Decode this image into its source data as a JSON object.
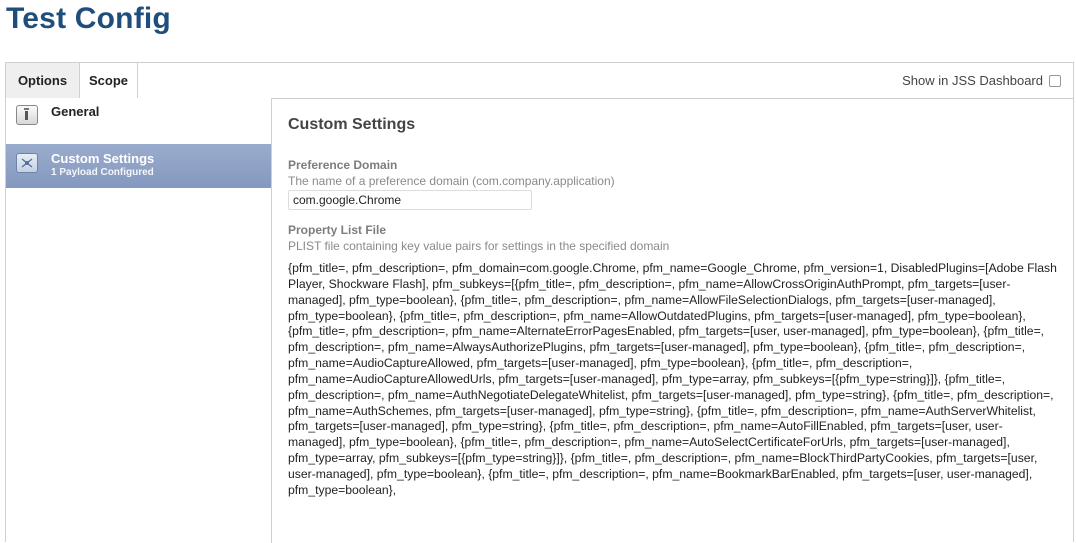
{
  "page": {
    "title": "Test Config"
  },
  "tabs": [
    {
      "label": "Options",
      "active": true
    },
    {
      "label": "Scope",
      "active": false
    }
  ],
  "dashboard": {
    "label": "Show in JSS Dashboard",
    "checked": false
  },
  "sidebar": {
    "items": [
      {
        "label": "General",
        "icon": "general-payload-icon"
      },
      {
        "label": "Custom Settings",
        "subtitle": "1 Payload Configured",
        "icon": "custom-settings-icon",
        "selected": true
      }
    ]
  },
  "main": {
    "section_title": "Custom Settings",
    "preference_domain": {
      "label": "Preference Domain",
      "description": "The name of a preference domain (com.company.application)",
      "value": "com.google.Chrome"
    },
    "plist": {
      "label": "Property List File",
      "description": "PLIST file containing key value pairs for settings in the specified domain",
      "content": "{pfm_title=, pfm_description=, pfm_domain=com.google.Chrome, pfm_name=Google_Chrome, pfm_version=1, DisabledPlugins=[Adobe Flash Player, Shockware Flash], pfm_subkeys=[{pfm_title=, pfm_description=, pfm_name=AllowCrossOriginAuthPrompt, pfm_targets=[user-managed], pfm_type=boolean}, {pfm_title=, pfm_description=, pfm_name=AllowFileSelectionDialogs, pfm_targets=[user-managed], pfm_type=boolean}, {pfm_title=, pfm_description=, pfm_name=AllowOutdatedPlugins, pfm_targets=[user-managed], pfm_type=boolean}, {pfm_title=, pfm_description=, pfm_name=AlternateErrorPagesEnabled, pfm_targets=[user, user-managed], pfm_type=boolean}, {pfm_title=, pfm_description=, pfm_name=AlwaysAuthorizePlugins, pfm_targets=[user-managed], pfm_type=boolean}, {pfm_title=, pfm_description=, pfm_name=AudioCaptureAllowed, pfm_targets=[user-managed], pfm_type=boolean}, {pfm_title=, pfm_description=, pfm_name=AudioCaptureAllowedUrls, pfm_targets=[user-managed], pfm_type=array, pfm_subkeys=[{pfm_type=string}]}, {pfm_title=, pfm_description=, pfm_name=AuthNegotiateDelegateWhitelist, pfm_targets=[user-managed], pfm_type=string}, {pfm_title=, pfm_description=, pfm_name=AuthSchemes, pfm_targets=[user-managed], pfm_type=string}, {pfm_title=, pfm_description=, pfm_name=AuthServerWhitelist, pfm_targets=[user-managed], pfm_type=string}, {pfm_title=, pfm_description=, pfm_name=AutoFillEnabled, pfm_targets=[user, user-managed], pfm_type=boolean}, {pfm_title=, pfm_description=, pfm_name=AutoSelectCertificateForUrls, pfm_targets=[user-managed], pfm_type=array, pfm_subkeys=[{pfm_type=string}]}, {pfm_title=, pfm_description=, pfm_name=BlockThirdPartyCookies, pfm_targets=[user, user-managed], pfm_type=boolean}, {pfm_title=, pfm_description=, pfm_name=BookmarkBarEnabled, pfm_targets=[user, user-managed], pfm_type=boolean},"
    }
  }
}
